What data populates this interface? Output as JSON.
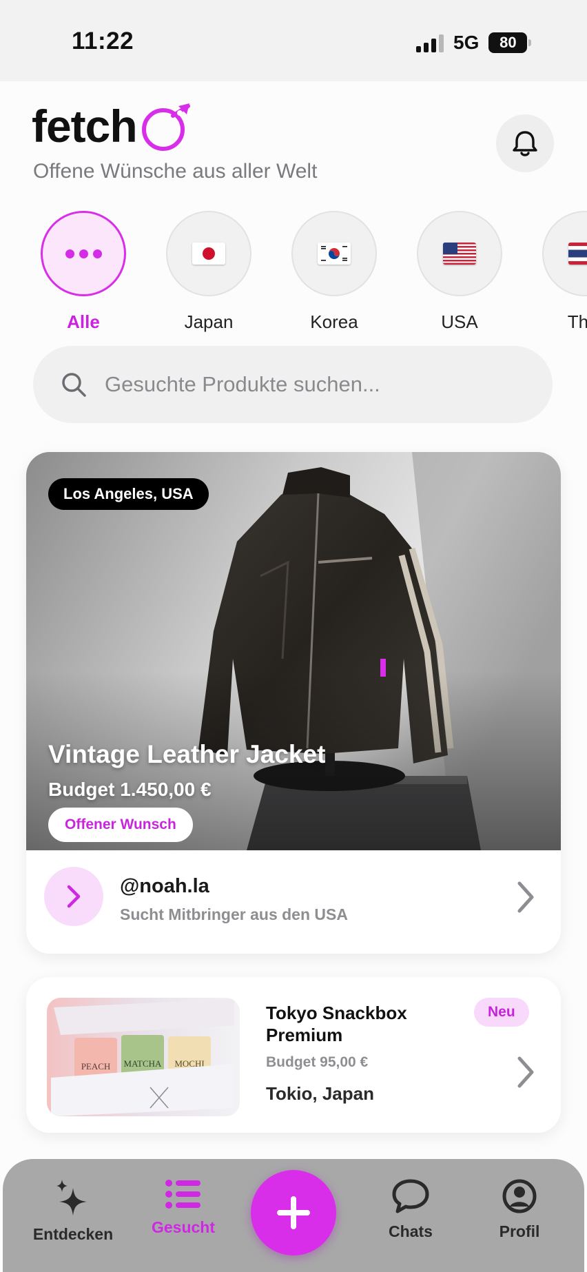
{
  "status_bar": {
    "time": "11:22",
    "network": "5G",
    "battery": "80"
  },
  "header": {
    "logo_text": "fetch",
    "subtitle": "Offene Wünsche aus aller Welt"
  },
  "categories": [
    {
      "label": "Alle",
      "icon": "more-dots-icon",
      "active": true
    },
    {
      "label": "Japan",
      "icon": "japan-flag-icon",
      "active": false
    },
    {
      "label": "Korea",
      "icon": "korea-flag-icon",
      "active": false
    },
    {
      "label": "USA",
      "icon": "usa-flag-icon",
      "active": false
    },
    {
      "label": "Thai",
      "icon": "thailand-flag-icon",
      "active": false
    }
  ],
  "search": {
    "placeholder": "Gesuchte Produkte suchen..."
  },
  "featured": {
    "location": "Los Angeles, USA",
    "title": "Vintage Leather Jacket",
    "budget": "Budget 1.450,00 €",
    "status": "Offener Wunsch",
    "user_handle": "@noah.la",
    "user_desc": "Sucht Mitbringer aus den USA"
  },
  "item2": {
    "title": "Tokyo Snackbox Premium",
    "badge": "Neu",
    "budget": "Budget 95,00 €",
    "location": "Tokio, Japan",
    "image_labels": [
      "PEACH",
      "MATCHA",
      "MOCHI"
    ]
  },
  "nav": {
    "items": [
      {
        "label": "Entdecken",
        "icon": "sparkle-icon"
      },
      {
        "label": "Gesucht",
        "icon": "list-icon"
      },
      {
        "label": "Chats",
        "icon": "chat-bubble-icon"
      },
      {
        "label": "Profil",
        "icon": "profile-icon"
      }
    ],
    "fab_icon": "plus-icon"
  },
  "colors": {
    "accent": "#d92ee9",
    "accent_light": "#fbe6fc",
    "nav_bg": "#a8a8a9"
  }
}
